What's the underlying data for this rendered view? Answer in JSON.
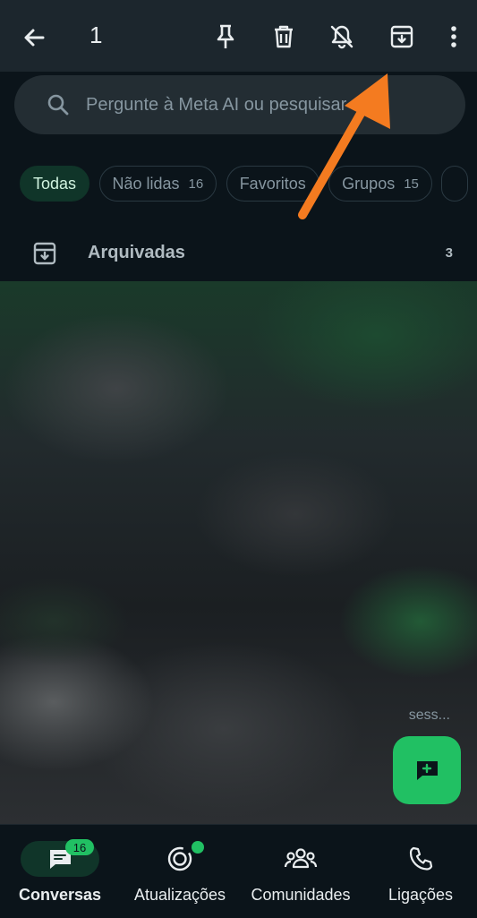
{
  "topbar": {
    "selected_count": "1",
    "back_icon": "arrow-left-icon",
    "actions": [
      "pin-icon",
      "trash-icon",
      "mute-bell-icon",
      "archive-icon",
      "more-vertical-icon"
    ]
  },
  "search": {
    "placeholder": "Pergunte à Meta AI ou pesquisar"
  },
  "filters": [
    {
      "label": "Todas",
      "count": ""
    },
    {
      "label": "Não lidas",
      "count": "16"
    },
    {
      "label": "Favoritos",
      "count": ""
    },
    {
      "label": "Grupos",
      "count": "15"
    }
  ],
  "archived": {
    "label": "Arquivadas",
    "count": "3"
  },
  "chat_list": {
    "preview_snippet": "sess..."
  },
  "fab": {
    "icon": "new-chat-icon"
  },
  "bottom_nav": {
    "chats": {
      "label": "Conversas",
      "badge": "16"
    },
    "updates": {
      "label": "Atualizações"
    },
    "communities": {
      "label": "Comunidades"
    },
    "calls": {
      "label": "Ligações"
    }
  },
  "colors": {
    "background": "#0b141a",
    "topbar": "#1c262d",
    "accent": "#21c063",
    "annotation_arrow": "#f47b20"
  }
}
